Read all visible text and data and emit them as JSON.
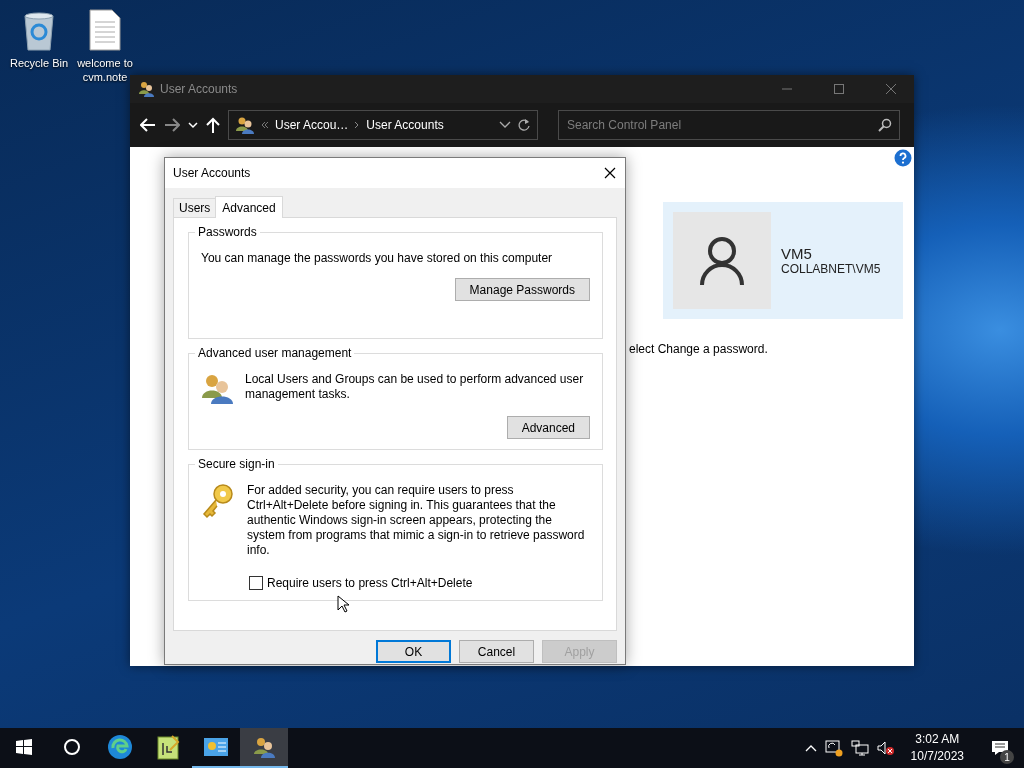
{
  "desktop_icons": [
    {
      "kind": "bin",
      "label": "Recycle Bin"
    },
    {
      "kind": "note",
      "label": "welcome to\ncvm.note"
    }
  ],
  "background_window": {
    "title": "User Accounts",
    "breadcrumb": [
      "User Accou…",
      "User Accounts"
    ],
    "search": {
      "placeholder": "Search Control Panel"
    },
    "user": {
      "name": "VM5",
      "account": "COLLABNET\\VM5"
    },
    "partial_text": "elect Change a password."
  },
  "dialog": {
    "title": "User Accounts",
    "tabs": [
      {
        "label": "Users",
        "selected": false
      },
      {
        "label": "Advanced",
        "selected": true
      }
    ],
    "groups": [
      {
        "kind": "passwords",
        "title": "Passwords",
        "text": "You can manage the passwords you have stored on this computer",
        "button": "Manage Passwords"
      },
      {
        "kind": "users",
        "title": "Advanced user management",
        "text": "Local Users and Groups can be used to perform advanced user management tasks.",
        "button": "Advanced"
      },
      {
        "kind": "key",
        "title": "Secure sign-in",
        "text": "For added security, you can require users to press Ctrl+Alt+Delete before signing in. This guarantees that the authentic Windows sign-in screen appears, protecting the system from programs that mimic a sign-in to retrieve password info.",
        "checkbox": {
          "label": "Require users to press Ctrl+Alt+Delete",
          "checked": false
        }
      }
    ],
    "buttons": [
      {
        "label": "OK",
        "default": true,
        "disabled": false
      },
      {
        "label": "Cancel",
        "default": false,
        "disabled": false
      },
      {
        "label": "Apply",
        "default": false,
        "disabled": true
      }
    ]
  },
  "taskbar": {
    "apps": [
      {
        "kind": "edge",
        "running": false,
        "active": false
      },
      {
        "kind": "notepad",
        "running": false,
        "active": false
      },
      {
        "kind": "panel",
        "running": true,
        "active": false
      },
      {
        "kind": "users",
        "running": true,
        "active": true
      }
    ],
    "clock": {
      "time": "3:02 AM",
      "date": "10/7/2023"
    },
    "notifications": "1"
  }
}
